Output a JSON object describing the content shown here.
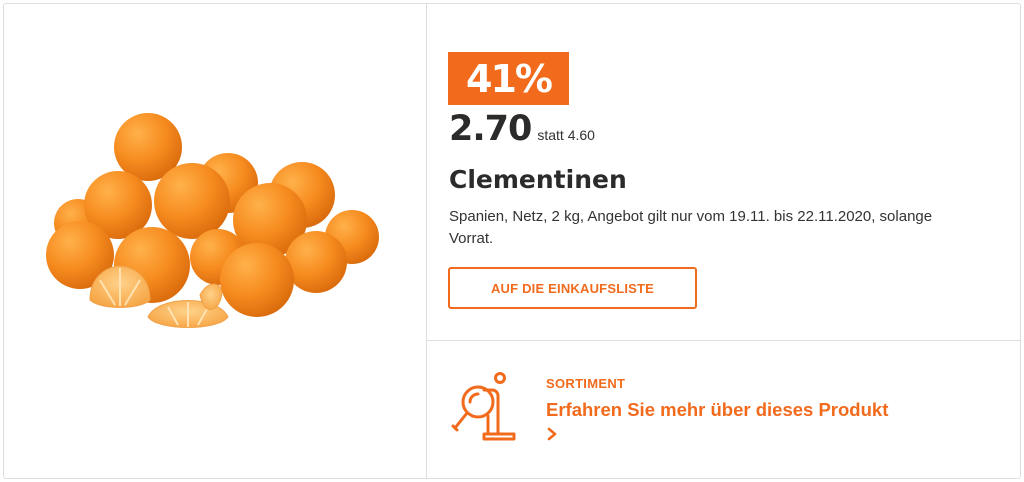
{
  "offer": {
    "discount": "41%",
    "price": "2.70",
    "old_price": "statt 4.60",
    "title": "Clementinen",
    "description": "Spanien, Netz, 2 kg, Angebot gilt nur vom 19.11. bis 22.11.2020, solange Vorrat.",
    "cta_label": "AUF DIE EINKAUFSLISTE",
    "image_icon": "clementines-photo"
  },
  "range": {
    "label": "SORTIMENT",
    "link_text": "Erfahren Sie mehr über dieses Produkt",
    "icon": "magnifier-product-icon",
    "chevron_icon": "chevron-right-icon"
  },
  "colors": {
    "accent": "#f26b1d",
    "text": "#333333",
    "border": "#dedede"
  }
}
